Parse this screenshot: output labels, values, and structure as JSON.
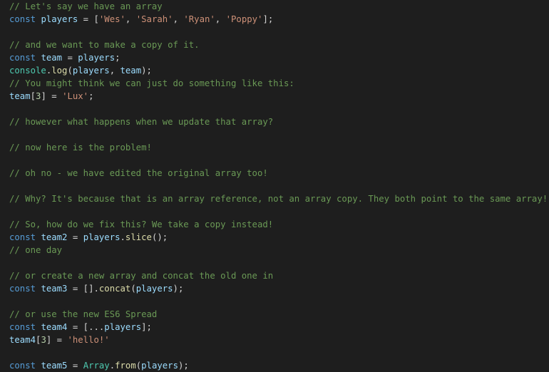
{
  "editor": {
    "background": "#1e1e1e",
    "lines": [
      [
        {
          "t": "// Let's say we have an array",
          "k": "comment"
        }
      ],
      [
        {
          "t": "const",
          "k": "keyword"
        },
        {
          "t": " ",
          "k": "punct"
        },
        {
          "t": "players",
          "k": "variable"
        },
        {
          "t": " = [",
          "k": "punct"
        },
        {
          "t": "'Wes'",
          "k": "string"
        },
        {
          "t": ", ",
          "k": "punct"
        },
        {
          "t": "'Sarah'",
          "k": "string"
        },
        {
          "t": ", ",
          "k": "punct"
        },
        {
          "t": "'Ryan'",
          "k": "string"
        },
        {
          "t": ", ",
          "k": "punct"
        },
        {
          "t": "'Poppy'",
          "k": "string"
        },
        {
          "t": "];",
          "k": "punct"
        }
      ],
      [],
      [
        {
          "t": "// and we want to make a copy of it.",
          "k": "comment"
        }
      ],
      [
        {
          "t": "const",
          "k": "keyword"
        },
        {
          "t": " ",
          "k": "punct"
        },
        {
          "t": "team",
          "k": "variable"
        },
        {
          "t": " = ",
          "k": "punct"
        },
        {
          "t": "players",
          "k": "variable"
        },
        {
          "t": ";",
          "k": "punct"
        }
      ],
      [
        {
          "t": "console",
          "k": "class"
        },
        {
          "t": ".",
          "k": "punct"
        },
        {
          "t": "log",
          "k": "function"
        },
        {
          "t": "(",
          "k": "punct"
        },
        {
          "t": "players",
          "k": "variable"
        },
        {
          "t": ", ",
          "k": "punct"
        },
        {
          "t": "team",
          "k": "variable"
        },
        {
          "t": ");",
          "k": "punct"
        }
      ],
      [
        {
          "t": "// You might think we can just do something like this:",
          "k": "comment"
        }
      ],
      [
        {
          "t": "team",
          "k": "variable"
        },
        {
          "t": "[",
          "k": "punct"
        },
        {
          "t": "3",
          "k": "number"
        },
        {
          "t": "] = ",
          "k": "punct"
        },
        {
          "t": "'Lux'",
          "k": "string"
        },
        {
          "t": ";",
          "k": "punct"
        }
      ],
      [],
      [
        {
          "t": "// however what happens when we update that array?",
          "k": "comment"
        }
      ],
      [],
      [
        {
          "t": "// now here is the problem!",
          "k": "comment"
        }
      ],
      [],
      [
        {
          "t": "// oh no - we have edited the original array too!",
          "k": "comment"
        }
      ],
      [],
      [
        {
          "t": "// Why? It's because that is an array reference, not an array copy. They both point to the same array!",
          "k": "comment"
        }
      ],
      [],
      [
        {
          "t": "// So, how do we fix this? We take a copy instead!",
          "k": "comment"
        }
      ],
      [
        {
          "t": "const",
          "k": "keyword"
        },
        {
          "t": " ",
          "k": "punct"
        },
        {
          "t": "team2",
          "k": "variable"
        },
        {
          "t": " = ",
          "k": "punct"
        },
        {
          "t": "players",
          "k": "variable"
        },
        {
          "t": ".",
          "k": "punct"
        },
        {
          "t": "slice",
          "k": "function"
        },
        {
          "t": "();",
          "k": "punct"
        }
      ],
      [
        {
          "t": "// one day",
          "k": "comment"
        }
      ],
      [],
      [
        {
          "t": "// or create a new array and concat the old one in",
          "k": "comment"
        }
      ],
      [
        {
          "t": "const",
          "k": "keyword"
        },
        {
          "t": " ",
          "k": "punct"
        },
        {
          "t": "team3",
          "k": "variable"
        },
        {
          "t": " = [].",
          "k": "punct"
        },
        {
          "t": "concat",
          "k": "function"
        },
        {
          "t": "(",
          "k": "punct"
        },
        {
          "t": "players",
          "k": "variable"
        },
        {
          "t": ");",
          "k": "punct"
        }
      ],
      [],
      [
        {
          "t": "// or use the new ES6 Spread",
          "k": "comment"
        }
      ],
      [
        {
          "t": "const",
          "k": "keyword"
        },
        {
          "t": " ",
          "k": "punct"
        },
        {
          "t": "team4",
          "k": "variable"
        },
        {
          "t": " = [...",
          "k": "punct"
        },
        {
          "t": "players",
          "k": "variable"
        },
        {
          "t": "];",
          "k": "punct"
        }
      ],
      [
        {
          "t": "team4",
          "k": "variable"
        },
        {
          "t": "[",
          "k": "punct"
        },
        {
          "t": "3",
          "k": "number"
        },
        {
          "t": "] = ",
          "k": "punct"
        },
        {
          "t": "'hello!'",
          "k": "string"
        }
      ],
      [],
      [
        {
          "t": "const",
          "k": "keyword"
        },
        {
          "t": " ",
          "k": "punct"
        },
        {
          "t": "team5",
          "k": "variable"
        },
        {
          "t": " = ",
          "k": "punct"
        },
        {
          "t": "Array",
          "k": "class"
        },
        {
          "t": ".",
          "k": "punct"
        },
        {
          "t": "from",
          "k": "function"
        },
        {
          "t": "(",
          "k": "punct"
        },
        {
          "t": "players",
          "k": "variable"
        },
        {
          "t": ");",
          "k": "punct"
        }
      ]
    ]
  },
  "colors": {
    "comment": "#6a9955",
    "keyword": "#569cd6",
    "variable": "#9cdcfe",
    "string": "#ce9178",
    "number": "#b5cea8",
    "function": "#dcdcaa",
    "class": "#4ec9b0",
    "punct": "#d4d4d4"
  }
}
